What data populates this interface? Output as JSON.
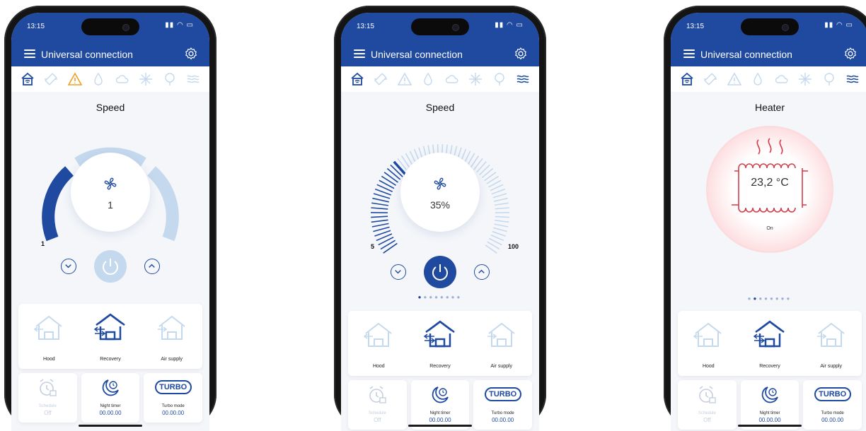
{
  "common": {
    "time": "13:15",
    "app_title": "Universal connection",
    "modes": [
      {
        "label": "Hood"
      },
      {
        "label": "Recovery"
      },
      {
        "label": "Air supply"
      }
    ],
    "schedule": {
      "label": "Schedule",
      "value": "Off"
    },
    "night_timer": {
      "label": "Night timer",
      "value": "00.00.00"
    },
    "turbo": {
      "badge": "TURBO",
      "label": "Turbo mode",
      "value": "00.00.00"
    }
  },
  "screens": [
    {
      "title": "Speed",
      "value": "1",
      "min_label": "1",
      "speed_level": 1,
      "speed_levels_total": 3,
      "power_on": false
    },
    {
      "title": "Speed",
      "value": "35%",
      "min_label": "5",
      "max_label": "100",
      "speed_percent": 35,
      "power_on": true
    },
    {
      "title": "Heater",
      "temperature": "23,2 °C",
      "status": "On"
    }
  ],
  "colors": {
    "primary": "#1f4aa0",
    "light_blue": "#c5d9ee",
    "warning": "#f0a020",
    "heater_red": "#d43b4a"
  }
}
